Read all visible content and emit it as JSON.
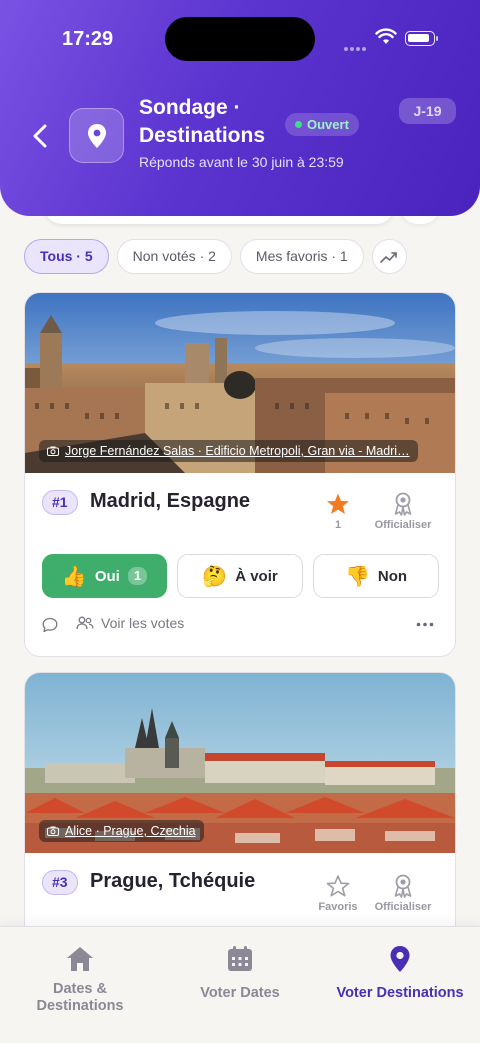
{
  "status_bar": {
    "time": "17:29"
  },
  "header": {
    "title": "Sondage · Destinations",
    "status": "Ouvert",
    "countdown": "J-19",
    "subtitle": "Réponds avant le 30 juin à 23:59"
  },
  "filters": [
    {
      "label": "Tous · 5",
      "active": true
    },
    {
      "label": "Non votés · 2",
      "active": false
    },
    {
      "label": "Mes favoris · 1",
      "active": false
    }
  ],
  "filters_icon": "trending-icon",
  "cards": [
    {
      "rank": "#1",
      "name": "Madrid, Espagne",
      "photo_credit": "Jorge Fernández Salas · Edificio Metropoli, Gran via - Madri…",
      "favorite_count": "1",
      "favorite_active": true,
      "officialize_label": "Officialiser",
      "votes": {
        "yes_label": "Oui",
        "yes_count": "1",
        "maybe_label": "À voir",
        "maybe_emoji": "🤔",
        "no_label": "Non",
        "yes_emoji": "👍",
        "no_emoji": "👎"
      },
      "see_votes_label": "Voir les votes"
    },
    {
      "rank": "#3",
      "name": "Prague, Tchéquie",
      "photo_credit": "Alice · Prague, Czechia",
      "favorite_label": "Favoris",
      "favorite_active": false,
      "officialize_label": "Officialiser"
    }
  ],
  "bottom_nav": [
    {
      "label": "Dates & Destinations",
      "icon": "home-icon",
      "active": false
    },
    {
      "label": "Voter Dates",
      "icon": "calendar-icon",
      "active": false
    },
    {
      "label": "Voter Destinations",
      "icon": "location-pin-icon",
      "active": true
    }
  ],
  "colors": {
    "header_gradient_start": "#7a52e3",
    "header_gradient_end": "#4a22bd",
    "accent": "#4a2fb4",
    "yes_green": "#3fae6d",
    "star_orange": "#f47c20",
    "status_green": "#45d893"
  }
}
